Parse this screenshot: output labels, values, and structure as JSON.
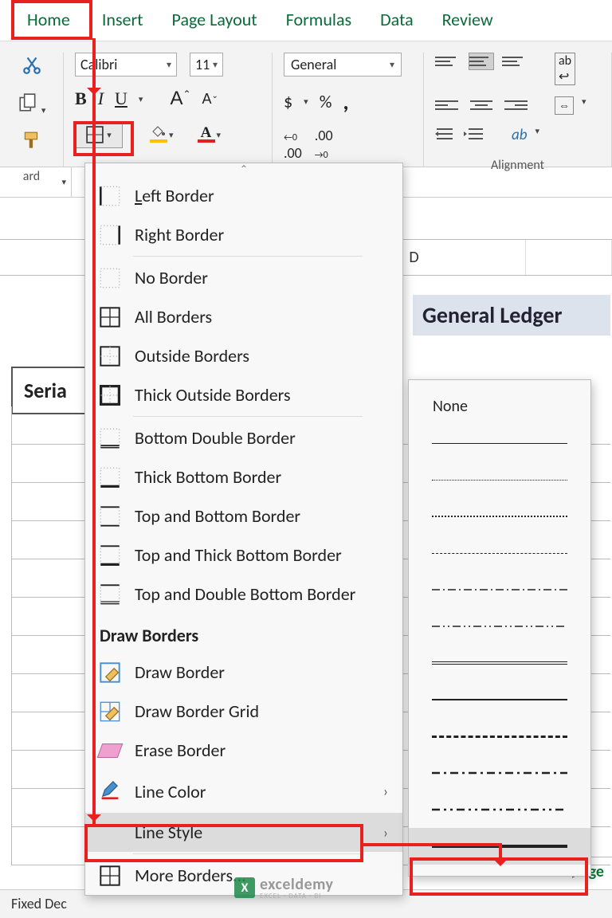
{
  "tabs": {
    "home": "Home",
    "insert": "Insert",
    "page_layout": "Page Layout",
    "formulas": "Formulas",
    "data": "Data",
    "review": "Review"
  },
  "clipboard": {
    "label": "ard"
  },
  "font": {
    "name": "Calibri",
    "size": "11",
    "bold": "B",
    "italic": "I",
    "underline": "U",
    "increase": "A",
    "decrease": "A",
    "fontcolor_letter": "A"
  },
  "number": {
    "format": "General",
    "currency": "$",
    "percent": "%",
    "comma": ",",
    "inc_dec": ".0",
    "dec_dec": ".00"
  },
  "alignment": {
    "label": "Alignment",
    "wrap": "ab"
  },
  "border_menu": {
    "left": "Left Border",
    "right": "Right Border",
    "none": "No Border",
    "all": "All Borders",
    "outside": "Outside Borders",
    "thick_outside": "Thick Outside Borders",
    "bottom_double": "Bottom Double Border",
    "thick_bottom": "Thick Bottom Border",
    "top_bottom": "Top and Bottom Border",
    "top_thick_bottom": "Top and Thick Bottom Border",
    "top_double_bottom": "Top and Double Bottom Border",
    "draw_heading": "Draw Borders",
    "draw": "Draw Border",
    "draw_grid": "Draw Border Grid",
    "erase": "Erase Border",
    "line_color": "Line Color",
    "line_style": "Line Style",
    "more": "More Borders..."
  },
  "line_style": {
    "none": "None"
  },
  "sheet": {
    "col_d": "D",
    "ledger_title": "General Ledger",
    "serial_hd": "Seria",
    "sheet_tab": "edge",
    "tab_scroll": "▸"
  },
  "status": {
    "fixed_dec": "Fixed Dec"
  },
  "watermark": {
    "brand": "exceldemy",
    "tag": "EXCEL · DATA · BI",
    "logo": "X"
  }
}
